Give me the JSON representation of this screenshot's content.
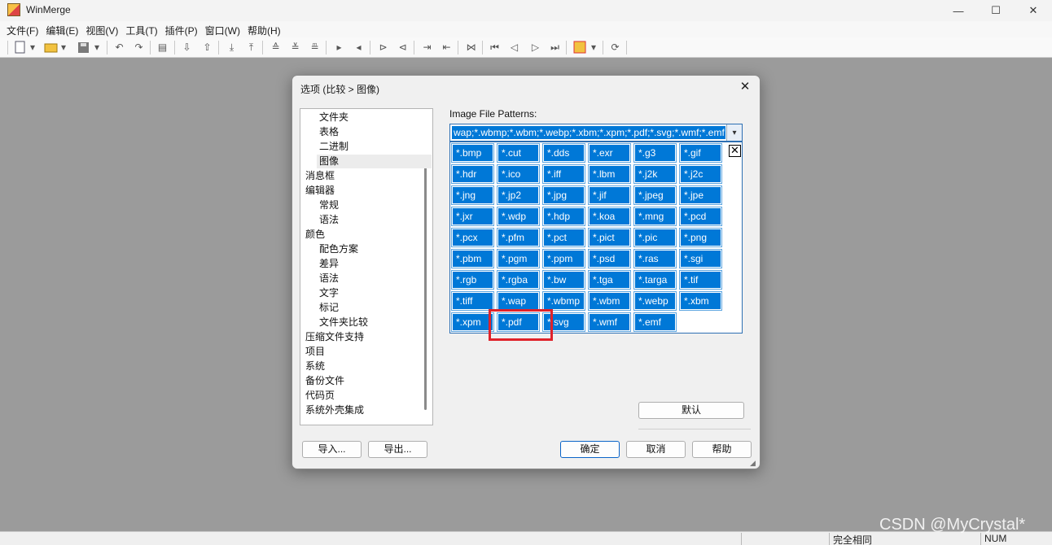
{
  "window": {
    "title": "WinMerge",
    "controls": [
      "—",
      "☐",
      "✕"
    ]
  },
  "menu": [
    "文件(F)",
    "编辑(E)",
    "视图(V)",
    "工具(T)",
    "插件(P)",
    "窗口(W)",
    "帮助(H)"
  ],
  "dialog": {
    "title": "选项 (比较 > 图像)",
    "tree": [
      {
        "label": "文件夹",
        "indent": true
      },
      {
        "label": "表格",
        "indent": true
      },
      {
        "label": "二进制",
        "indent": true
      },
      {
        "label": "图像",
        "indent": true,
        "selected": true
      },
      {
        "label": "消息框",
        "indent": false
      },
      {
        "label": "编辑器",
        "indent": false
      },
      {
        "label": "常规",
        "indent": true
      },
      {
        "label": "语法",
        "indent": true
      },
      {
        "label": "颜色",
        "indent": false
      },
      {
        "label": "配色方案",
        "indent": true
      },
      {
        "label": "差异",
        "indent": true
      },
      {
        "label": "语法",
        "indent": true
      },
      {
        "label": "文字",
        "indent": true
      },
      {
        "label": "标记",
        "indent": true
      },
      {
        "label": "文件夹比较",
        "indent": true
      },
      {
        "label": "压缩文件支持",
        "indent": false
      },
      {
        "label": "项目",
        "indent": false
      },
      {
        "label": "系统",
        "indent": false
      },
      {
        "label": "备份文件",
        "indent": false
      },
      {
        "label": "代码页",
        "indent": false
      },
      {
        "label": "系统外壳集成",
        "indent": false
      }
    ],
    "patterns_label": "Image File Patterns:",
    "patterns_value": "wap;*.wbmp;*.wbm;*.webp;*.xbm;*.xpm;*.pdf;*.svg;*.wmf;*.emf",
    "patterns": [
      "*.bmp",
      "*.cut",
      "*.dds",
      "*.exr",
      "*.g3",
      "*.gif",
      "*.hdr",
      "*.ico",
      "*.iff",
      "*.lbm",
      "*.j2k",
      "*.j2c",
      "*.jng",
      "*.jp2",
      "*.jpg",
      "*.jif",
      "*.jpeg",
      "*.jpe",
      "*.jxr",
      "*.wdp",
      "*.hdp",
      "*.koa",
      "*.mng",
      "*.pcd",
      "*.pcx",
      "*.pfm",
      "*.pct",
      "*.pict",
      "*.pic",
      "*.png",
      "*.pbm",
      "*.pgm",
      "*.ppm",
      "*.psd",
      "*.ras",
      "*.sgi",
      "*.rgb",
      "*.rgba",
      "*.bw",
      "*.tga",
      "*.targa",
      "*.tif",
      "*.tiff",
      "*.wap",
      "*.wbmp",
      "*.wbm",
      "*.webp",
      "*.xbm",
      "*.xpm",
      "*.pdf",
      "*.svg",
      "*.wmf",
      "*.emf"
    ],
    "popup_close": "✕",
    "default_button": "默认",
    "import_button": "导入...",
    "export_button": "导出...",
    "ok_button": "确定",
    "cancel_button": "取消",
    "help_button": "帮助",
    "close_glyph": "✕"
  },
  "status": {
    "compare_result": "完全相同",
    "num": "NUM"
  },
  "watermark": "CSDN @MyCrystal*",
  "colors": {
    "chip": "#0078d7",
    "highlight": "#e0222a",
    "workspace": "#9b9b9b"
  }
}
